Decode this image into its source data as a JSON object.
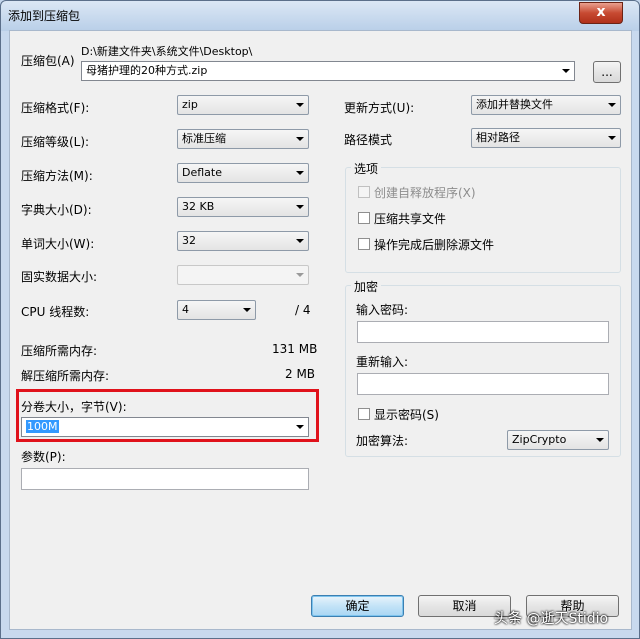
{
  "window": {
    "title": "添加到压缩包",
    "close": "x"
  },
  "archive": {
    "label": "压缩包(A)",
    "path": "D:\\新建文件夹\\系统文件\\Desktop\\",
    "name": "母猪护理的20种方式.zip",
    "browse": "..."
  },
  "left": {
    "format": {
      "label": "压缩格式(F):",
      "value": "zip"
    },
    "level": {
      "label": "压缩等级(L):",
      "value": "标准压缩"
    },
    "method": {
      "label": "压缩方法(M):",
      "value": "Deflate"
    },
    "dict": {
      "label": "字典大小(D):",
      "value": "32 KB"
    },
    "word": {
      "label": "单词大小(W):",
      "value": "32"
    },
    "solid": {
      "label": "固实数据大小:",
      "value": ""
    },
    "threads": {
      "label": "CPU 线程数:",
      "value": "4",
      "total": "/ 4"
    },
    "mem_compress": {
      "label": "压缩所需内存:",
      "value": "131 MB"
    },
    "mem_decompress": {
      "label": "解压缩所需内存:",
      "value": "2 MB"
    },
    "split": {
      "label": "分卷大小，字节(V):",
      "value": "100M"
    },
    "params": {
      "label": "参数(P):",
      "value": ""
    }
  },
  "right": {
    "update": {
      "label": "更新方式(U):",
      "value": "添加并替换文件"
    },
    "pathmode": {
      "label": "路径模式",
      "value": "相对路径"
    },
    "options": {
      "title": "选项",
      "sfx": "创建自释放程序(X)",
      "shared": "压缩共享文件",
      "delete": "操作完成后删除源文件"
    },
    "encrypt": {
      "title": "加密",
      "password": "输入密码:",
      "reenter": "重新输入:",
      "show": "显示密码(S)",
      "method_label": "加密算法:",
      "method": "ZipCrypto"
    }
  },
  "buttons": {
    "ok": "确定",
    "cancel": "取消",
    "help": "帮助"
  },
  "watermark": "头条 @逝天Stidio"
}
